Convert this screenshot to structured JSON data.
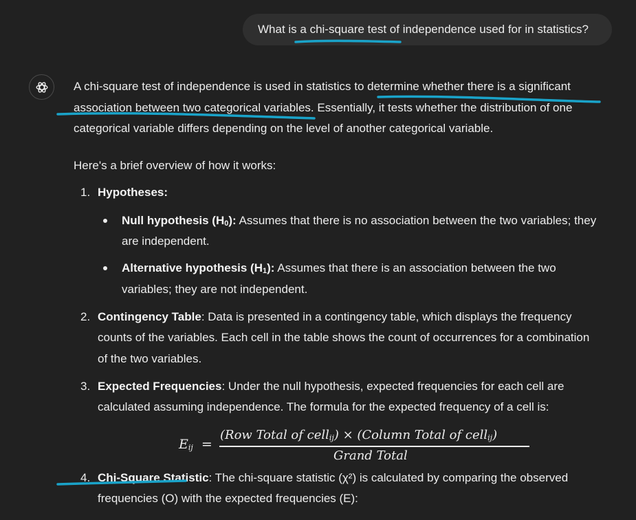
{
  "user": {
    "question": "What is a chi-square test of independence used for in statistics?"
  },
  "assistant": {
    "intro_lines": [
      "A chi-square test of independence is used in statistics to determine whether there is a significant",
      "association between two categorical variables. Essentially, it tests whether the distribution of one",
      "categorical variable differs depending on the level of another categorical variable."
    ],
    "overview": "Here's a brief overview of how it works:",
    "items": [
      {
        "num": "1.",
        "title": "Hypotheses:",
        "lines": [],
        "bullets": [
          {
            "title": "Null hypothesis (H",
            "sub": "0",
            "title_end": "):",
            "lines": [
              "Assumes that there is no association between the two variables; they",
              "are independent."
            ]
          },
          {
            "title": "Alternative hypothesis (H",
            "sub": "1",
            "title_end": "):",
            "lines": [
              "Assumes that there is an association between the two",
              "variables; they are not independent."
            ]
          }
        ]
      },
      {
        "num": "2.",
        "title": "Contingency Table",
        "lines": [
          ": Data is presented in a contingency table, which displays the frequency",
          "counts of the variables. Each cell in the table shows the count of occurrences for a combination",
          "of the two variables."
        ]
      },
      {
        "num": "3.",
        "title": "Expected Frequencies",
        "lines": [
          ": Under the null hypothesis, expected frequencies for each cell are",
          "calculated assuming independence. The formula for the expected frequency of a cell is:"
        ]
      },
      {
        "num": "4.",
        "title": "Chi-Square Statistic",
        "lines": [
          ": The chi-square statistic (χ²) is calculated by comparing the observed",
          "frequencies (O) with the expected frequencies (E):"
        ]
      }
    ],
    "formula": {
      "lhs": "E",
      "lhs_sub": "ij",
      "equals": "=",
      "numerator": "(Row Total of cell",
      "numerator_sub": "ij",
      "numerator_mid": ") × (Column Total of cell",
      "numerator_sub2": "ij",
      "numerator_end": ")",
      "denominator": "Grand Total"
    }
  },
  "colors": {
    "background": "#212121",
    "bubble": "#2f2f2f",
    "text": "#ececec",
    "annotation": "#1aa3c9"
  },
  "icons": {
    "assistant_avatar": "openai-logo-icon"
  }
}
